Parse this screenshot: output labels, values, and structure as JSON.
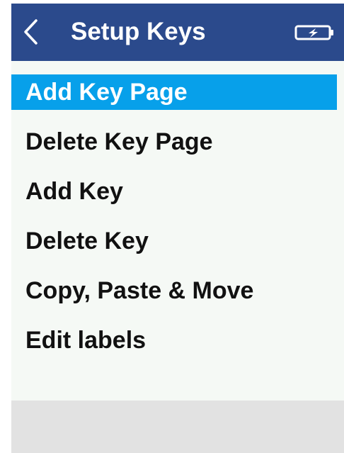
{
  "header": {
    "title": "Setup Keys",
    "back_icon": "chevron-left-icon",
    "battery_icon": "battery-charging-icon",
    "background_color": "#2b4a8c"
  },
  "menu": {
    "selected_index": 0,
    "selected_color": "#07a0ea",
    "items": [
      {
        "label": "Add Key Page"
      },
      {
        "label": "Delete Key Page"
      },
      {
        "label": "Add Key"
      },
      {
        "label": "Delete Key"
      },
      {
        "label": "Copy, Paste & Move"
      },
      {
        "label": "Edit labels"
      }
    ]
  }
}
